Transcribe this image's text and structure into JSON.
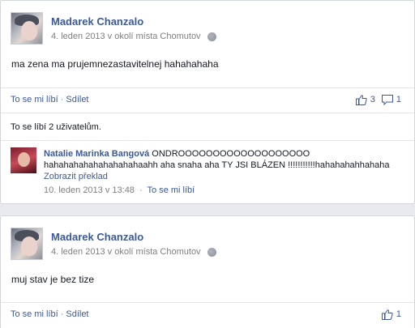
{
  "posts": [
    {
      "author": "Madarek Chanzalo",
      "date": "4. leden 2013",
      "location_prefix": "v okolí místa",
      "location": "Chomutov",
      "text": "ma zena ma prujemnezastavitelnej hahahahaha",
      "like_label": "To se mi líbí",
      "share_label": "Sdílet",
      "like_count": "3",
      "comment_count": "1",
      "likes_summary": "To se líbí 2 uživatelům.",
      "comment": {
        "author": "Natalie Marinka Bangová",
        "text_line1": "ONDROOOOOOOOOOOOOOOOOOO",
        "text_line2": "hahahahahahahahahahaahh aha snaha aha TY JSI BLÁZEN !!!!!!!!!!!hahahahahhahaha",
        "translate_label": "Zobrazit překlad",
        "time": "10. leden 2013 v 13:48",
        "like_label": "To se mi líbí"
      }
    },
    {
      "author": "Madarek Chanzalo",
      "date": "4. leden 2013",
      "location_prefix": "v okolí místa",
      "location": "Chomutov",
      "text": "muj stav je bez tize",
      "like_label": "To se mi líbí",
      "share_label": "Sdílet",
      "like_count": "1"
    }
  ],
  "colors": {
    "link": "#3b5998",
    "background": "#e9eaed",
    "meta": "#7f7f7f"
  }
}
